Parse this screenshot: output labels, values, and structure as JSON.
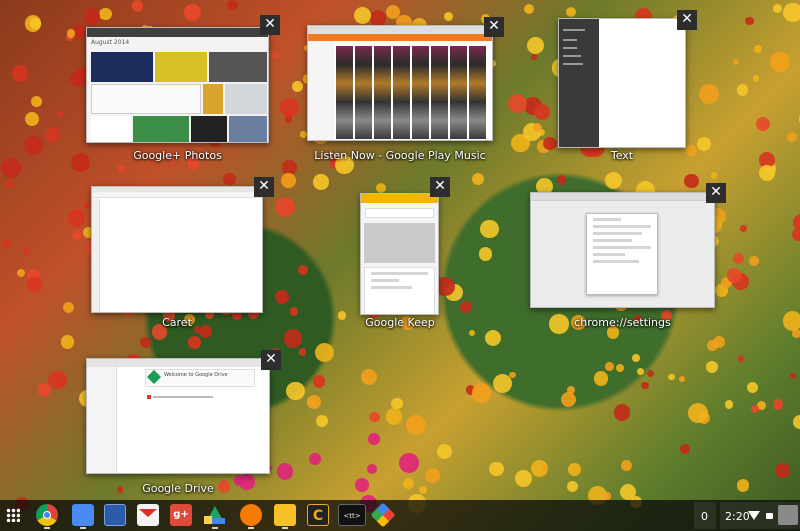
{
  "windows": [
    {
      "title": "Google+ Photos",
      "header_label": "August 2014"
    },
    {
      "title": "Listen Now - Google Play Music"
    },
    {
      "title": "Text"
    },
    {
      "title": "Caret"
    },
    {
      "title": "Google Keep"
    },
    {
      "title": "chrome://settings"
    },
    {
      "title": "Google Drive",
      "banner": "Welcome to Google Drive"
    }
  ],
  "close_glyph": "✕",
  "shelf": {
    "apps": [
      "chrome-icon",
      "files-icon",
      "chrome-window-icon",
      "gmail-icon",
      "google-plus-icon",
      "drive-icon",
      "play-music-icon",
      "keep-icon",
      "caret-icon",
      "terminal-icon",
      "photos-icon"
    ],
    "terminal_label": "<tt>",
    "caret_label": "C",
    "notification_count": "0",
    "clock": "2:20"
  }
}
